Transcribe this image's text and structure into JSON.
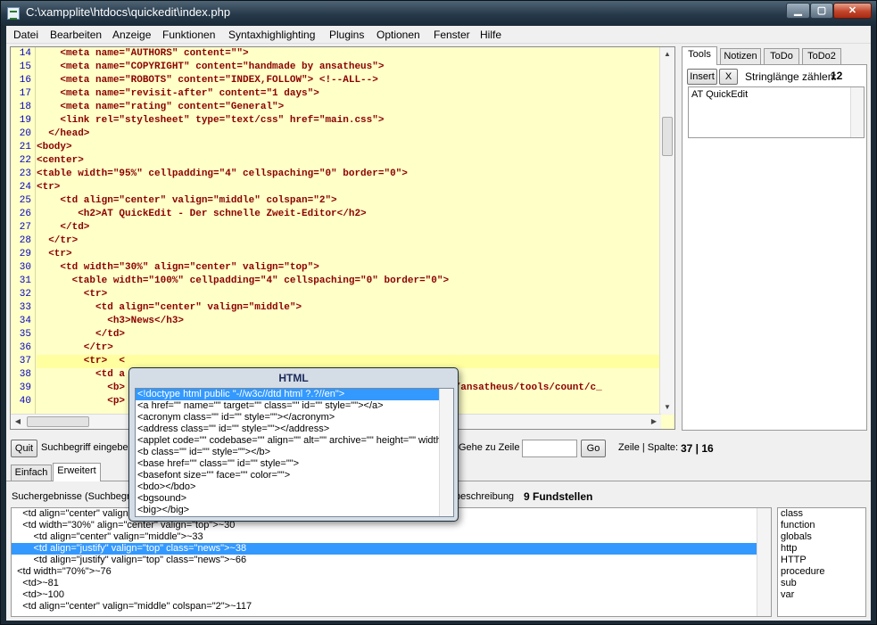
{
  "window": {
    "title": "C:\\xampplite\\htdocs\\quickedit\\index.php"
  },
  "menu": [
    "Datei",
    "Bearbeiten",
    "Anzeige",
    "Funktionen",
    "Syntaxhighlighting",
    "Plugins",
    "Optionen",
    "Fenster",
    "Hilfe"
  ],
  "editor": {
    "line_numbers": [
      "14",
      "15",
      "16",
      "17",
      "18",
      "19",
      "20",
      "21",
      "22",
      "23",
      "24",
      "25",
      "26",
      "27",
      "28",
      "29",
      "30",
      "31",
      "32",
      "33",
      "34",
      "35",
      "36",
      "37",
      "38",
      "39",
      "40"
    ],
    "lines": [
      "    <meta name=\"AUTHORS\" content=\"\">",
      "    <meta name=\"COPYRIGHT\" content=\"handmade by ansatheus\">",
      "    <meta name=\"ROBOTS\" content=\"INDEX,FOLLOW\"> <!--ALL-->",
      "    <meta name=\"revisit-after\" content=\"1 days\">",
      "    <meta name=\"rating\" content=\"General\">",
      "    <link rel=\"stylesheet\" type=\"text/css\" href=\"main.css\">",
      "  </head>",
      "<body>",
      "<center>",
      "<table width=\"95%\" cellpadding=\"4\" cellspaching=\"0\" border=\"0\">",
      "<tr>",
      "    <td align=\"center\" valign=\"middle\" colspan=\"2\">",
      "       <h2>AT QuickEdit - Der schnelle Zweit-Editor</h2>",
      "    </td>",
      "  </tr>",
      "  <tr>",
      "    <td width=\"30%\" align=\"center\" valign=\"top\">",
      "      <table width=\"100%\" cellpadding=\"4\" cellspaching=\"0\" border=\"0\">",
      "        <tr>",
      "          <td align=\"center\" valign=\"middle\">",
      "            <h3>News</h3>",
      "          </td>",
      "        </tr>",
      "        <tr>  <",
      "          <td a",
      "            <b>                                                 rcor.de/ansatheus/tools/count/c_",
      "            <p>"
    ],
    "current_line_index": 23
  },
  "right_panel": {
    "tabs": [
      "Tools",
      "Notizen",
      "ToDo",
      "ToDo2"
    ],
    "insert_label": "Insert",
    "x_label": "X",
    "strlen_label": "Stringlänge zählen:",
    "strlen_value": "12",
    "notes_text": "AT QuickEdit"
  },
  "search_bar": {
    "quit_label": "Quit",
    "search_label": "Suchbegriff eingeben",
    "goto_label": "Gehe zu Zeile",
    "go_label": "Go",
    "pos_label": "Zeile | Spalte:",
    "pos_value": "37 | 16"
  },
  "search_tabs": [
    "Einfach",
    "Erweitert"
  ],
  "results": {
    "label": "Suchergebnisse (Suchbegriff",
    "desc": "beschreibung",
    "count": "9 Fundstellen",
    "lines": [
      "    <td align=\"center\" valign",
      "    <td width=\"30%\" align=\"center\" valign=\"top\">~30",
      "        <td align=\"center\" valign=\"middle\">~33",
      "        <td align=\"justify\" valign=\"top\" class=\"news\">~38",
      "        <td align=\"justify\" valign=\"top\" class=\"news\">~66",
      "  <td width=\"70%\">~76",
      "    <td>~81",
      "    <td>~100",
      "    <td align=\"center\" valign=\"middle\" colspan=\"2\">~117"
    ],
    "selected_index": 3
  },
  "keywords": [
    "class",
    "function",
    "globals",
    "http",
    "HTTP",
    "procedure",
    "sub",
    "var"
  ],
  "popup": {
    "title": "HTML",
    "items": [
      "<!doctype html public \"-//w3c//dtd html ?.?//en\">",
      "<a href=\"\" name=\"\" target=\"\" class=\"\" id=\"\" style=\"\"></a>",
      "<acronym class=\"\" id=\"\" style=\"\"></acronym>",
      "<address class=\"\" id=\"\" style=\"\"></address>",
      "<applet code=\"\" codebase=\"\" align=\"\" alt=\"\" archive=\"\" height=\"\" width=\"\" cl",
      "<b class=\"\" id=\"\" style=\"\"></b>",
      "<base href=\"\" class=\"\" id=\"\" style=\"\">",
      "<basefont size=\"\" face=\"\" color=\"\">",
      "<bdo></bdo>",
      "<bgsound>",
      "<big></big>"
    ],
    "selected_index": 0
  },
  "colors": {
    "editor_bg": "#ffffc8",
    "line_number": "#0000c0",
    "code_text": "#8b0000",
    "selection": "#3399ff"
  }
}
